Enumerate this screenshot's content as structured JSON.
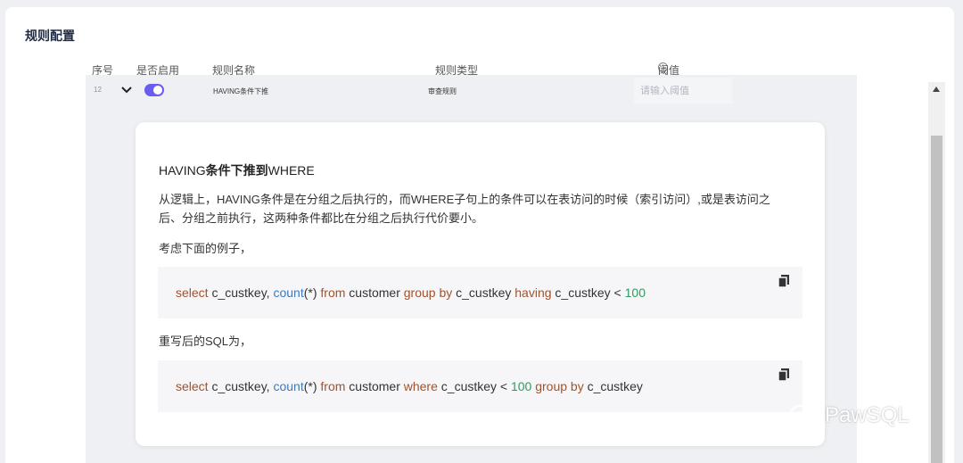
{
  "section": {
    "title": "规则配置"
  },
  "table": {
    "columns": {
      "index": "序号",
      "enabled": "是否启用",
      "name": "规则名称",
      "type": "规则类型",
      "threshold": "阈值"
    }
  },
  "row": {
    "index": "12",
    "enabled": true,
    "name": "HAVING条件下推",
    "type": "审查规则",
    "threshold_placeholder": "请输入阈值",
    "threshold_value": ""
  },
  "detail": {
    "title_prefix": "HAVING",
    "title_bold": "条件下推到",
    "title_suffix": "WHERE",
    "description": "从逻辑上，HAVING条件是在分组之后执行的，而WHERE子句上的条件可以在表访问的时候（索引访问）,或是表访问之后、分组之前执行，这两种条件都比在分组之后执行代价要小。",
    "example_label": "考虑下面的例子，",
    "code1": {
      "tokens": [
        {
          "text": "select",
          "cls": "kw"
        },
        {
          "text": " c_custkey, ",
          "cls": ""
        },
        {
          "text": "count",
          "cls": "fn"
        },
        {
          "text": "(*) ",
          "cls": ""
        },
        {
          "text": "from",
          "cls": "kw"
        },
        {
          "text": " customer ",
          "cls": ""
        },
        {
          "text": "group by",
          "cls": "kw"
        },
        {
          "text": " c_custkey ",
          "cls": ""
        },
        {
          "text": "having",
          "cls": "kw"
        },
        {
          "text": " c_custkey < ",
          "cls": ""
        },
        {
          "text": "100",
          "cls": "num"
        }
      ]
    },
    "rewrite_label": "重写后的SQL为，",
    "code2": {
      "tokens": [
        {
          "text": "select",
          "cls": "kw"
        },
        {
          "text": " c_custkey, ",
          "cls": ""
        },
        {
          "text": "count",
          "cls": "fn"
        },
        {
          "text": "(*) ",
          "cls": ""
        },
        {
          "text": "from",
          "cls": "kw"
        },
        {
          "text": " customer ",
          "cls": ""
        },
        {
          "text": "where",
          "cls": "kw"
        },
        {
          "text": " c_custkey < ",
          "cls": ""
        },
        {
          "text": "100",
          "cls": "num"
        },
        {
          "text": " ",
          "cls": ""
        },
        {
          "text": "group by",
          "cls": "kw"
        },
        {
          "text": " c_custkey",
          "cls": ""
        }
      ]
    }
  },
  "icons": {
    "chevron": "chevron-down-icon",
    "copy": "copy-icon",
    "info": "info-icon"
  },
  "colors": {
    "toggle_on": "#6b5cf0",
    "keyword": "#a0532c",
    "function": "#3b7bbf",
    "number": "#2e9a5e"
  },
  "watermark": {
    "text": "PawSQL"
  }
}
